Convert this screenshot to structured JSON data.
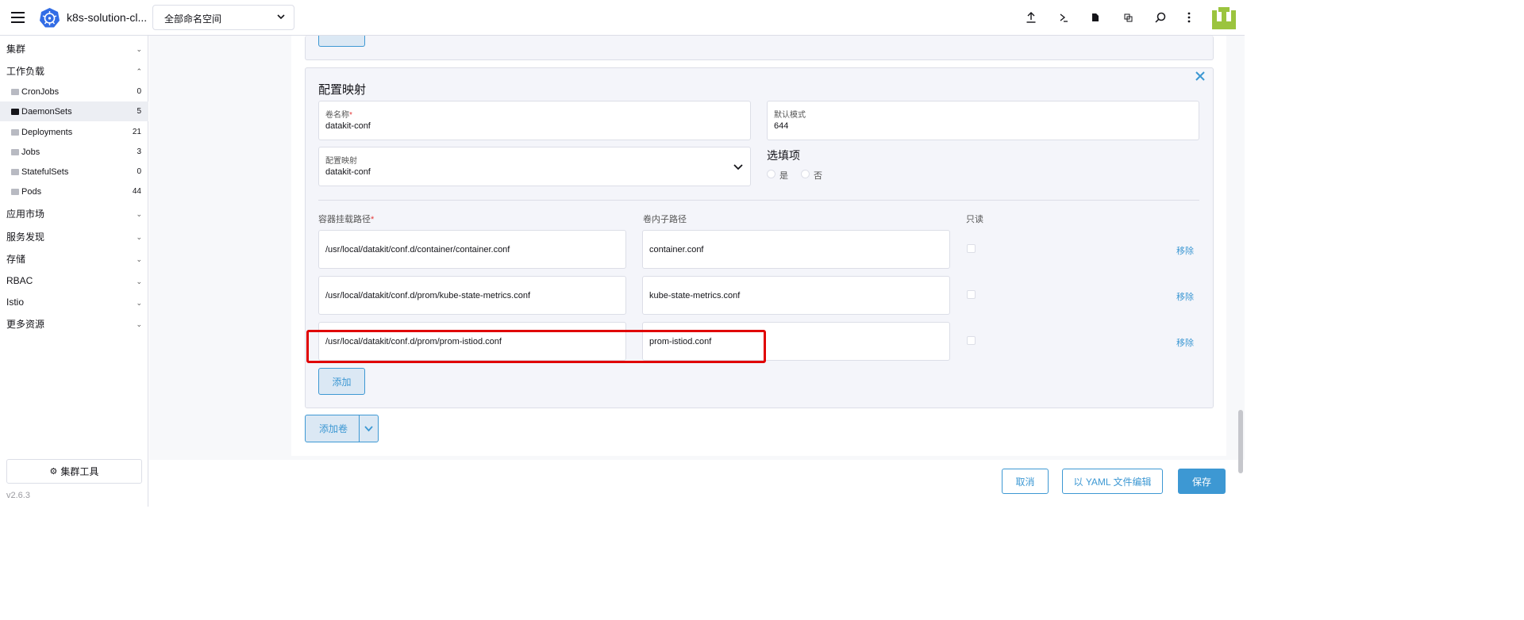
{
  "header": {
    "cluster_name": "k8s-solution-cl...",
    "namespace_value": "全部命名空间",
    "icons": [
      "upload-icon",
      "shell-icon",
      "file-icon",
      "copy-icon",
      "search-icon",
      "more-icon"
    ]
  },
  "sidebar": {
    "groups": [
      {
        "label": "集群"
      },
      {
        "label": "工作负载"
      },
      {
        "label": "应用市场"
      },
      {
        "label": "服务发现"
      },
      {
        "label": "存储"
      },
      {
        "label": "RBAC"
      },
      {
        "label": "Istio"
      },
      {
        "label": "更多资源"
      }
    ],
    "items": [
      {
        "label": "CronJobs",
        "count": "0"
      },
      {
        "label": "DaemonSets",
        "count": "5"
      },
      {
        "label": "Deployments",
        "count": "21"
      },
      {
        "label": "Jobs",
        "count": "3"
      },
      {
        "label": "StatefulSets",
        "count": "0"
      },
      {
        "label": "Pods",
        "count": "44"
      }
    ],
    "tools_label": "集群工具",
    "version": "v2.6.3"
  },
  "configmap": {
    "title": "配置映射",
    "volume_name_label": "卷名称",
    "volume_name_value": "datakit-conf",
    "default_mode_label": "默认模式",
    "default_mode_value": "644",
    "configmap_label": "配置映射",
    "configmap_value": "datakit-conf",
    "optional_label": "选填项",
    "optional_yes": "是",
    "optional_no": "否",
    "col_mount_path": "容器挂载路径",
    "col_sub_path": "卷内子路径",
    "col_readonly": "只读",
    "mounts": [
      {
        "path": "/usr/local/datakit/conf.d/container/container.conf",
        "sub_path": "container.conf",
        "remove": "移除"
      },
      {
        "path": "/usr/local/datakit/conf.d/prom/kube-state-metrics.conf",
        "sub_path": "kube-state-metrics.conf",
        "remove": "移除"
      },
      {
        "path": "/usr/local/datakit/conf.d/prom/prom-istiod.conf",
        "sub_path": "prom-istiod.conf",
        "remove": "移除"
      }
    ],
    "add_label": "添加"
  },
  "add_volume_label": "添加卷",
  "footer": {
    "cancel": "取消",
    "yaml_edit": "以 YAML 文件编辑",
    "save": "保存"
  },
  "colors": {
    "accent": "#3d98d3",
    "highlight": "#e00000",
    "required": "#e53b3b"
  }
}
